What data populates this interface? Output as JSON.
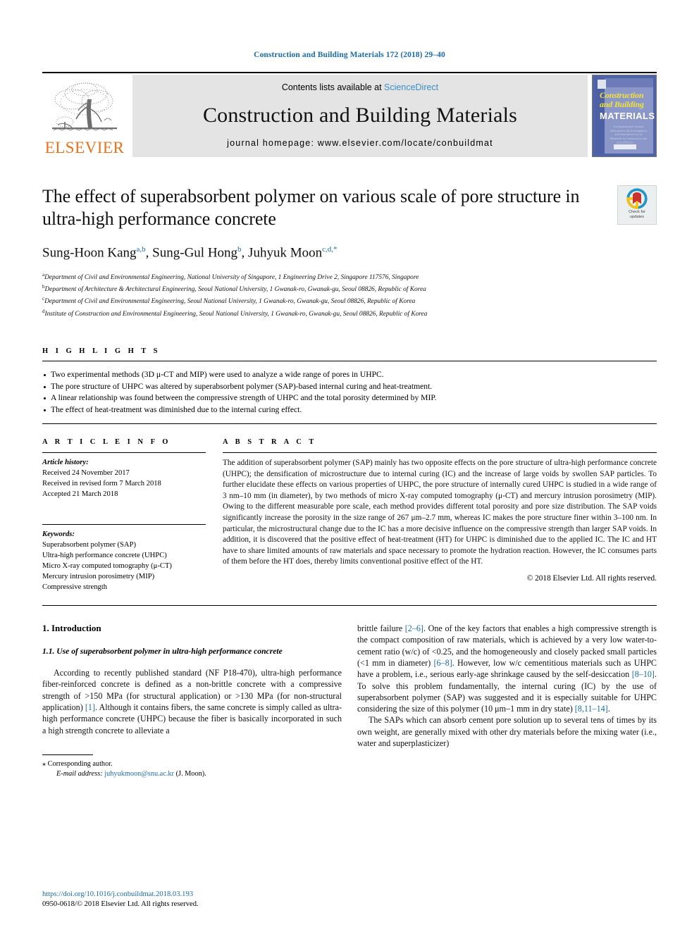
{
  "running_head": "Construction and Building Materials 172 (2018) 29–40",
  "journal_header": {
    "publisher_name": "ELSEVIER",
    "contents_prefix": "Contents lists available at ",
    "contents_link": "ScienceDirect",
    "journal_title": "Construction and Building Materials",
    "homepage": "journal homepage: www.elsevier.com/locate/conbuildmat",
    "cover": {
      "line1": "Construction",
      "line2": "and Building",
      "line3": "MATERIALS",
      "blurb": "An International Journal dedicated to the Investigation and Innovative Use of Materials in Construction and Repair"
    }
  },
  "article": {
    "title": "The effect of superabsorbent polymer on various scale of pore structure in ultra-high performance concrete",
    "authors_html": "Sung-Hoon Kang<sup>a,b</sup>, Sung-Gul Hong<sup>b</sup>, Juhyuk Moon<sup>c,d,</sup><sup>*</sup>",
    "affiliations": [
      "Department of Civil and Environmental Engineering, National University of Singapore, 1 Engineering Drive 2, Singapore 117576, Singapore",
      "Department of Architecture & Architectural Engineering, Seoul National University, 1 Gwanak-ro, Gwanak-gu, Seoul 08826, Republic of Korea",
      "Department of Civil and Environmental Engineering, Seoul National University, 1 Gwanak-ro, Gwanak-gu, Seoul 08826, Republic of Korea",
      "Institute of Construction and Environmental Engineering, Seoul National University, 1 Gwanak-ro, Gwanak-gu, Seoul 08826, Republic of Korea"
    ],
    "affiliation_marks": [
      "a",
      "b",
      "c",
      "d"
    ],
    "crossmark_label_line1": "Check for",
    "crossmark_label_line2": "updates"
  },
  "highlights": {
    "heading": "H I G H L I G H T S",
    "items": [
      "Two experimental methods (3D μ-CT and MIP) were used to analyze a wide range of pores in UHPC.",
      "The pore structure of UHPC was altered by superabsorbent polymer (SAP)-based internal curing and heat-treatment.",
      "A linear relationship was found between the compressive strength of UHPC and the total porosity determined by MIP.",
      "The effect of heat-treatment was diminished due to the internal curing effect."
    ]
  },
  "article_info": {
    "heading": "A R T I C L E   I N F O",
    "history_label": "Article history:",
    "history": [
      "Received 24 November 2017",
      "Received in revised form 7 March 2018",
      "Accepted 21 March 2018"
    ],
    "keywords_label": "Keywords:",
    "keywords": [
      "Superabsorbent polymer (SAP)",
      "Ultra-high performance concrete (UHPC)",
      "Micro X-ray computed tomography (μ-CT)",
      "Mercury intrusion porosimetry (MIP)",
      "Compressive strength"
    ]
  },
  "abstract": {
    "heading": "A B S T R A C T",
    "body": "The addition of superabsorbent polymer (SAP) mainly has two opposite effects on the pore structure of ultra-high performance concrete (UHPC); the densification of microstructure due to internal curing (IC) and the increase of large voids by swollen SAP particles. To further elucidate these effects on various properties of UHPC, the pore structure of internally cured UHPC is studied in a wide range of 3 nm–10 mm (in diameter), by two methods of micro X-ray computed tomography (μ-CT) and mercury intrusion porosimetry (MIP). Owing to the different measurable pore scale, each method provides different total porosity and pore size distribution. The SAP voids significantly increase the porosity in the size range of 267 μm–2.7 mm, whereas IC makes the pore structure finer within 3–100 nm. In particular, the microstructural change due to the IC has a more decisive influence on the compressive strength than larger SAP voids. In addition, it is discovered that the positive effect of heat-treatment (HT) for UHPC is diminished due to the applied IC. The IC and HT have to share limited amounts of raw materials and space necessary to promote the hydration reaction. However, the IC consumes parts of them before the HT does, thereby limits conventional positive effect of the HT.",
    "copyright": "© 2018 Elsevier Ltd. All rights reserved."
  },
  "body": {
    "section_number_title": "1. Introduction",
    "subsection_title": "1.1. Use of superabsorbent polymer in ultra-high performance concrete",
    "left_paragraph_parts": {
      "p1a": "According to recently published standard (NF P18-470), ultra-high performance fiber-reinforced concrete is defined as a non-brittle concrete with a compressive strength of >150 MPa (for structural application) or >130 MPa (for non-structural application) ",
      "p1_ref": "[1]",
      "p1b": ". Although it contains fibers, the same concrete is simply called as ultra-high performance concrete (UHPC) because the fiber is basically incorporated in such a high strength concrete to alleviate a"
    },
    "right_paragraph_parts": {
      "r1a": "brittle failure ",
      "r1_ref1": "[2–6]",
      "r1b": ". One of the key factors that enables a high compressive strength is the compact composition of raw materials, which is achieved by a very low water-to-cement ratio (w/c) of <0.25, and the homogeneously and closely packed small particles (<1 mm in diameter) ",
      "r1_ref2": "[6–8]",
      "r1c": ". However, low w/c cementitious materials such as UHPC have a problem, i.e., serious early-age shrinkage caused by the self-desiccation ",
      "r1_ref3": "[8–10]",
      "r1d": ". To solve this problem fundamentally, the internal curing (IC) by the use of superabsorbent polymer (SAP) was suggested and it is especially suitable for UHPC considering the size of this polymer (10 μm–1 mm in dry state) ",
      "r1_ref4": "[8,11–14]",
      "r1e": ".",
      "r2": "The SAPs which can absorb cement pore solution up to several tens of times by its own weight, are generally mixed with other dry materials before the mixing water (i.e., water and superplasticizer)"
    }
  },
  "footnote": {
    "star": "⁎",
    "corresponding": "Corresponding author.",
    "email_label": "E-mail address:",
    "email": "juhyukmoon@snu.ac.kr",
    "email_suffix": "(J. Moon)."
  },
  "footer": {
    "doi": "https://doi.org/10.1016/j.conbuildmat.2018.03.193",
    "issn_line": "0950-0618/© 2018 Elsevier Ltd. All rights reserved."
  },
  "colors": {
    "link_blue": "#1c6ca8",
    "science_direct_blue": "#3c8dc5",
    "elsevier_orange": "#E9711C",
    "header_band_gray": "#e4e4e4",
    "cover_blue": "#4c60a6",
    "cover_yellow": "#f2e23a"
  }
}
